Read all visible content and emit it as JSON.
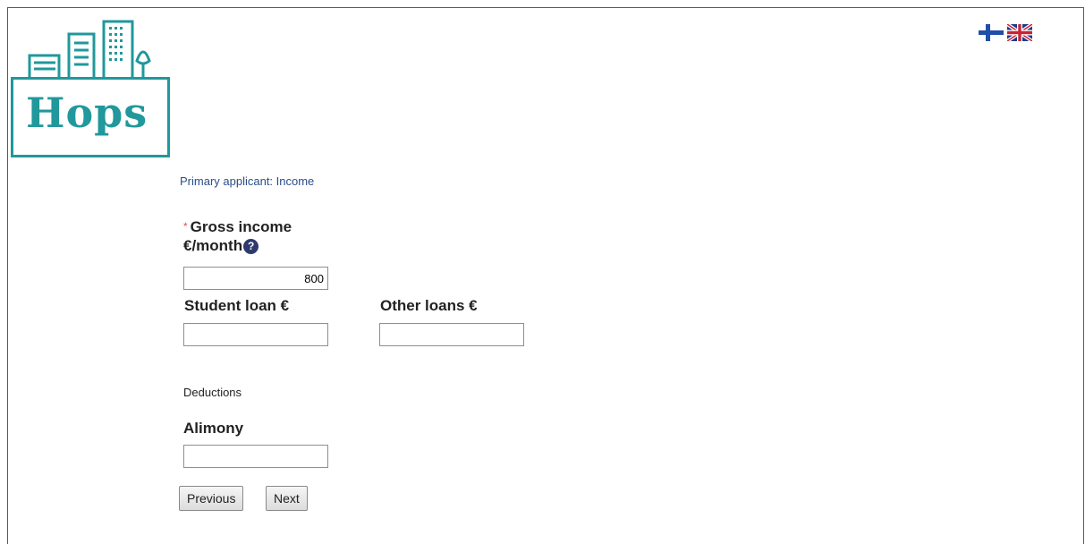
{
  "logo": {
    "text": "Hops"
  },
  "languages": [
    {
      "name": "Finnish",
      "icon": "finland-flag-icon"
    },
    {
      "name": "English",
      "icon": "uk-flag-icon"
    }
  ],
  "section_title": "Primary applicant: Income",
  "gross_income": {
    "required_marker": "*",
    "label_line1": "Gross income",
    "label_line2": "€/month",
    "help_icon": "?",
    "value": "800"
  },
  "student_loan": {
    "label": "Student loan €",
    "value": ""
  },
  "other_loans": {
    "label": "Other loans €",
    "value": ""
  },
  "deductions_label": "Deductions",
  "alimony": {
    "label": "Alimony",
    "value": ""
  },
  "buttons": {
    "previous": "Previous",
    "next": "Next"
  },
  "colors": {
    "brand": "#20989c",
    "link": "#2a4e8a",
    "required": "#d9534f",
    "help": "#2e3a6e"
  }
}
